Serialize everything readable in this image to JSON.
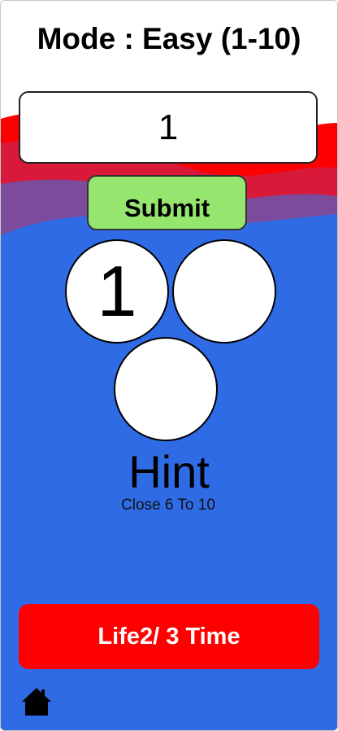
{
  "header": {
    "title": "Mode : Easy (1-10)"
  },
  "guess": {
    "value": "1"
  },
  "submit": {
    "label": "Submit"
  },
  "attempts": [
    {
      "value": "1"
    },
    {
      "value": ""
    },
    {
      "value": ""
    }
  ],
  "hint": {
    "title": "Hint",
    "text": "Close 6 To 10"
  },
  "life": {
    "label": "Life2/ 3 Time"
  },
  "nav": {
    "home_icon": "home-icon"
  },
  "colors": {
    "background_blue": "#2f6be5",
    "wave_red": "#ff0000",
    "wave_crimson": "#d8193a",
    "wave_purple": "#7c4b9c",
    "submit_green": "#96e56e",
    "life_red": "#ff0000"
  }
}
